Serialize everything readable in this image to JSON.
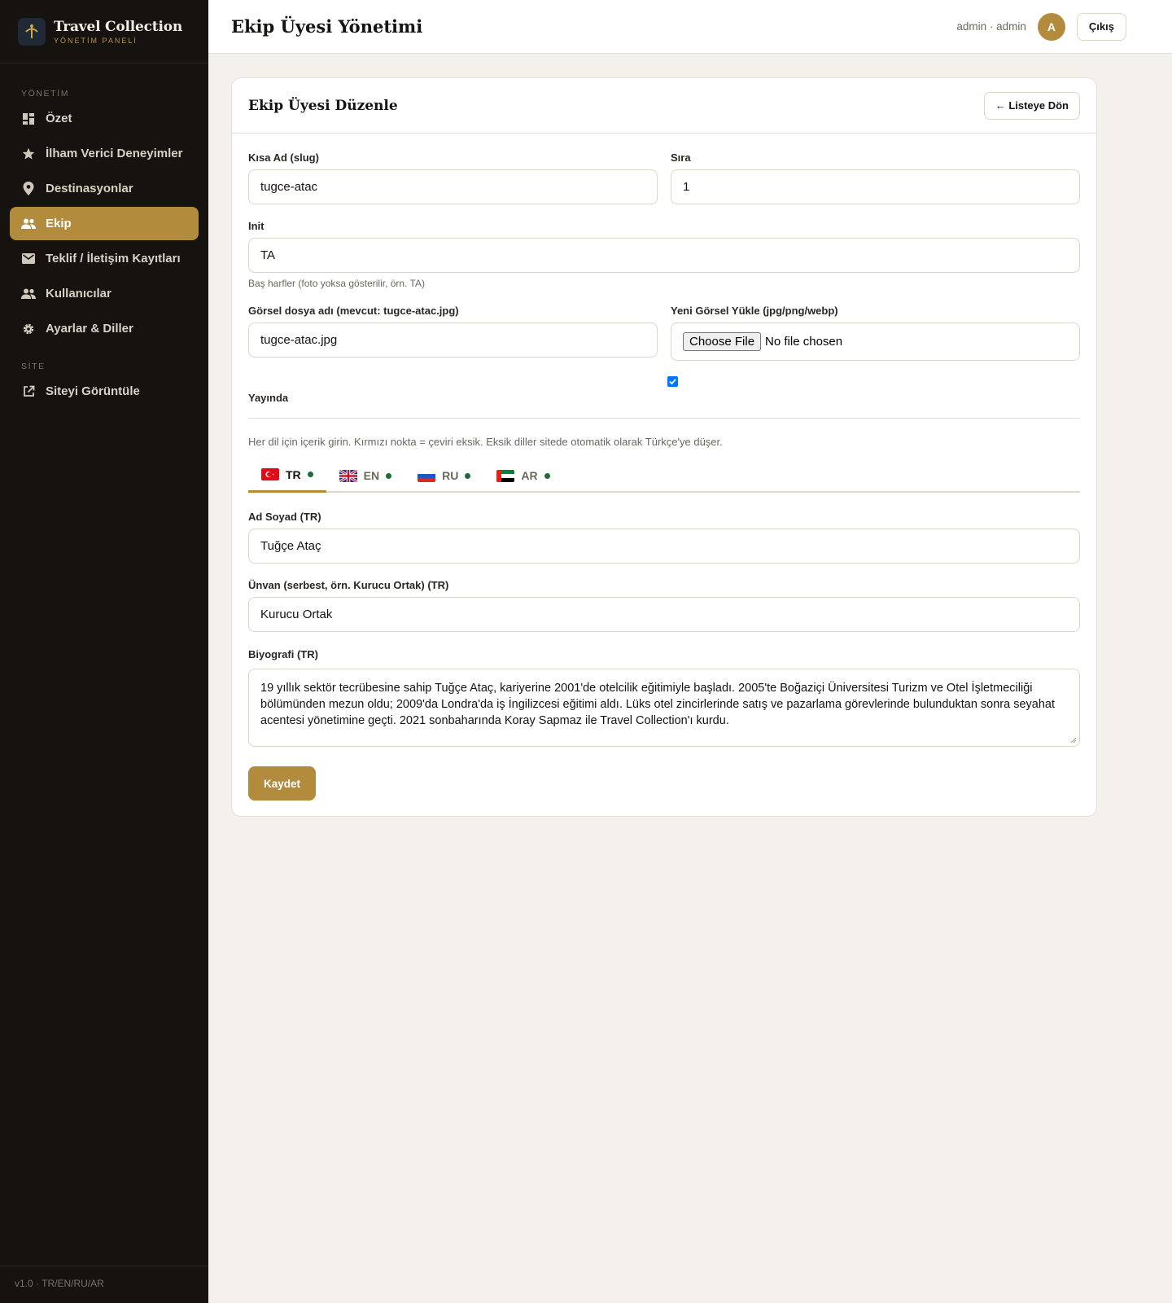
{
  "brand": {
    "title": "Travel Collection",
    "subtitle": "YÖNETİM PANELİ"
  },
  "sidebar": {
    "section_manage": "YÖNETİM",
    "items": [
      {
        "label": "Özet",
        "icon": "dashboard-icon"
      },
      {
        "label": "İlham Verici Deneyimler",
        "icon": "star-icon"
      },
      {
        "label": "Destinasyonlar",
        "icon": "map-pin-icon"
      },
      {
        "label": "Ekip",
        "icon": "people-icon",
        "active": true
      },
      {
        "label": "Teklif / İletişim Kayıtları",
        "icon": "mail-icon"
      },
      {
        "label": "Kullanıcılar",
        "icon": "users-icon"
      },
      {
        "label": "Ayarlar & Diller",
        "icon": "gear-icon"
      }
    ],
    "section_site": "SİTE",
    "site_items": [
      {
        "label": "Siteyi Görüntüle",
        "icon": "external-link-icon"
      }
    ],
    "footer": "v1.0 · TR/EN/RU/AR"
  },
  "header": {
    "title": "Ekip Üyesi Yönetimi",
    "user": "admin · admin",
    "avatar": "A",
    "logout": "Çıkış"
  },
  "card": {
    "title": "Ekip Üyesi Düzenle",
    "back": "← Listeye Dön"
  },
  "form": {
    "slug_label": "Kısa Ad (slug)",
    "slug_value": "tugce-atac",
    "order_label": "Sıra",
    "order_value": "1",
    "init_label": "Init",
    "init_value": "TA",
    "init_help": "Baş harfler (foto yoksa gösterilir, örn. TA)",
    "image_label": "Görsel dosya adı (mevcut: tugce-atac.jpg)",
    "image_value": "tugce-atac.jpg",
    "upload_label": "Yeni Görsel Yükle (jpg/png/webp)",
    "upload_button": "Choose File",
    "upload_status": "No file chosen",
    "published_label": "Yayında",
    "published": true,
    "lang_note": "Her dil için içerik girin. Kırmızı nokta = çeviri eksik. Eksik diller sitede otomatik olarak Türkçe'ye düşer.",
    "tabs": [
      {
        "code": "TR",
        "complete": true
      },
      {
        "code": "EN",
        "complete": true
      },
      {
        "code": "RU",
        "complete": true
      },
      {
        "code": "AR",
        "complete": true
      }
    ],
    "name_label": "Ad Soyad (TR)",
    "name_value": "Tuğçe Ataç",
    "title_label": "Ünvan (serbest, örn. Kurucu Ortak) (TR)",
    "title_value": "Kurucu Ortak",
    "bio_label": "Biyografi (TR)",
    "bio_value": "19 yıllık sektör tecrübesine sahip Tuğçe Ataç, kariyerine 2001'de otelcilik eğitimiyle başladı. 2005'te Boğaziçi Üniversitesi Turizm ve Otel İşletmeciliği bölümünden mezun oldu; 2009'da Londra'da iş İngilizcesi eğitimi aldı. Lüks otel zincirlerinde satış ve pazarlama görevlerinde bulunduktan sonra seyahat acentesi yönetimine geçti. 2021 sonbaharında Koray Sapmaz ile Travel Collection'ı kurdu.",
    "save": "Kaydet"
  },
  "colors": {
    "accent": "#b38b3c",
    "sidebar": "#15120f",
    "background": "#f4f1ec",
    "status_complete": "#1f6a37"
  }
}
